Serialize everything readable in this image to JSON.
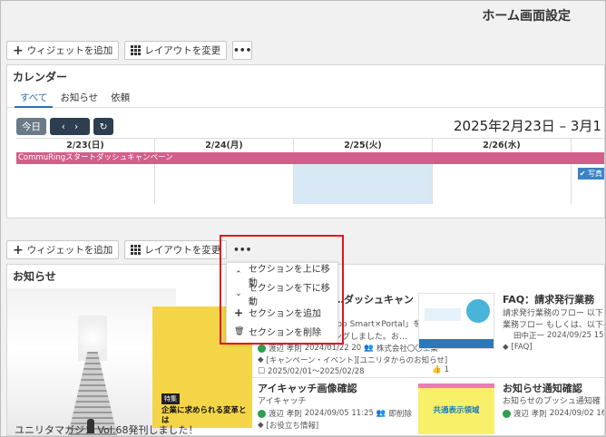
{
  "page_title": "ホーム画面設定",
  "toolbar_top": {
    "add_widget": "ウィジェットを追加",
    "change_layout": "レイアウトを変更",
    "more": "•••"
  },
  "toolbar_mid": {
    "add_widget": "ウィジェットを追加",
    "change_layout": "レイアウトを変更",
    "more": "•••"
  },
  "calendar": {
    "title": "カレンダー",
    "tabs": [
      "すべて",
      "お知らせ",
      "依頼"
    ],
    "today_label": "今日",
    "range": "2025年2月23日 – 3月1",
    "days": [
      "2/23(日)",
      "2/24(月)",
      "2/25(火)",
      "2/26(水)"
    ],
    "event": "CommuRingスタートダッシュキャンペーン",
    "badge": "写真"
  },
  "section_menu": {
    "items": [
      {
        "icon": "chevron-up-icon",
        "label": "セクションを上に移動"
      },
      {
        "icon": "chevron-down-icon",
        "label": "セクションを下に移動"
      },
      {
        "icon": "plus-icon",
        "label": "セクションを追加"
      },
      {
        "icon": "trash-icon",
        "label": "セクションを削除"
      }
    ]
  },
  "news": {
    "title": "お知らせ",
    "magazine": {
      "tag": "特集",
      "headline": "企業に求められる変革とは",
      "caption": "ユニリタマガジン Vol.68発刊しました！"
    },
    "card1": {
      "title": "…ダッシュキャン",
      "text1": "top Smart×Portal」を",
      "text2": "ングしました。お…",
      "author": "渡辺 孝則",
      "date": "2024/01/22 20",
      "org": "株式会社〇〇工業",
      "category": "[キャンペーン・イベント][ユニリタからのお知らせ]",
      "period": "2025/02/01〜2025/02/28",
      "likes": "1"
    },
    "card2": {
      "title": "FAQ：請求発行業務",
      "text1": "請求発行業務のフロー 以下を",
      "text2": "業務フロー もしくは、以下の",
      "author": "田中正一",
      "date": "2024/09/25 15",
      "category": "[FAQ]"
    },
    "card3": {
      "title": "アイキャッチ画像確認",
      "sub": "アイキャッチ",
      "author": "渡辺 孝則",
      "date": "2024/09/05 11:25",
      "org": "即削除",
      "category": "[お役立ち情報]"
    },
    "card4": {
      "title": "お知らせ通知確認",
      "sub": "お知らせのプッシュ通知確",
      "author": "渡辺 孝則",
      "date": "2024/09/02 16",
      "thumb": "共通表示領域"
    }
  }
}
